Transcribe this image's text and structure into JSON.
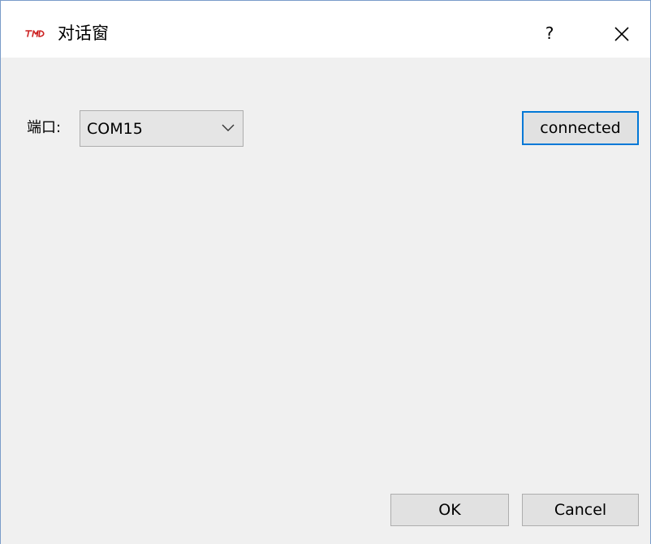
{
  "window": {
    "title": "对话窗",
    "help_label": "?",
    "logo_icon": "tmd-logo-icon",
    "close_icon": "close-icon"
  },
  "port": {
    "label": "端口:",
    "selected": "COM15",
    "dropdown_icon": "chevron-down-icon"
  },
  "connect_button": {
    "label": "connected"
  },
  "footer": {
    "ok_label": "OK",
    "cancel_label": "Cancel"
  },
  "colors": {
    "accent_focus": "#0078d7",
    "logo_red": "#cc1f1f",
    "client_bg": "#f0f0f0"
  }
}
